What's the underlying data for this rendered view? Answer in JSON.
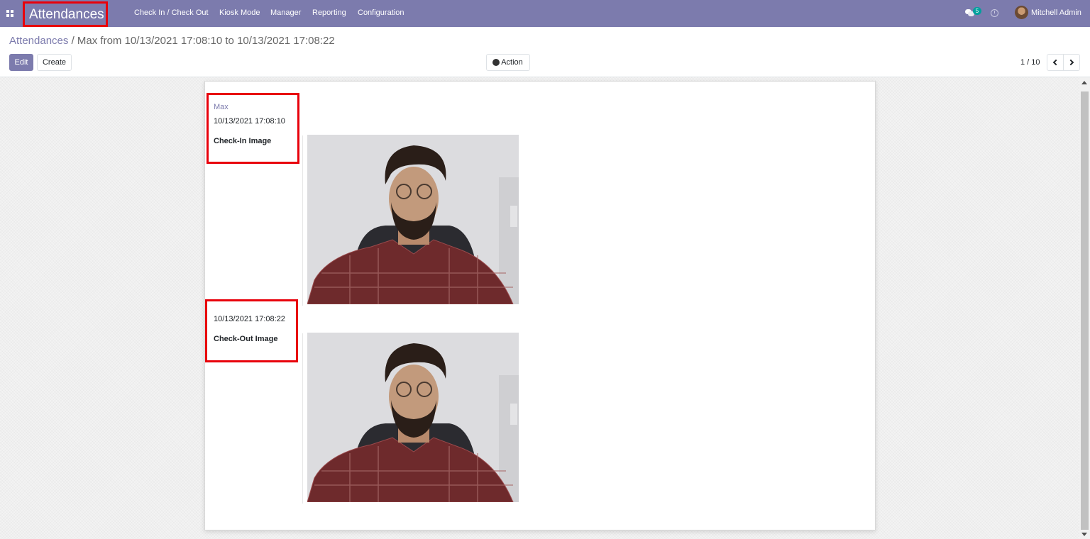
{
  "navbar": {
    "app_title": "Attendances",
    "menu": [
      "Check In / Check Out",
      "Kiosk Mode",
      "Manager",
      "Reporting",
      "Configuration"
    ],
    "notifications_count": "5",
    "user_name": "Mitchell Admin"
  },
  "breadcrumb": {
    "parent": "Attendances",
    "separator": "/",
    "current": "Max from 10/13/2021 17:08:10 to 10/13/2021 17:08:22"
  },
  "toolbar": {
    "edit_label": "Edit",
    "create_label": "Create",
    "action_label": "Action"
  },
  "pager": {
    "value": "1 / 10"
  },
  "record": {
    "employee": "Max",
    "check_in": "10/13/2021 17:08:10",
    "check_in_image_label": "Check-In Image",
    "check_out": "10/13/2021 17:08:22",
    "check_out_image_label": "Check-Out Image"
  },
  "colors": {
    "brand": "#7c7bad",
    "highlight": "#e8000b",
    "badge": "#00a09d"
  },
  "icons": [
    "apps-grid-icon",
    "chat-icon",
    "clock-icon",
    "gear-icon",
    "chevron-left-icon",
    "chevron-right-icon"
  ]
}
